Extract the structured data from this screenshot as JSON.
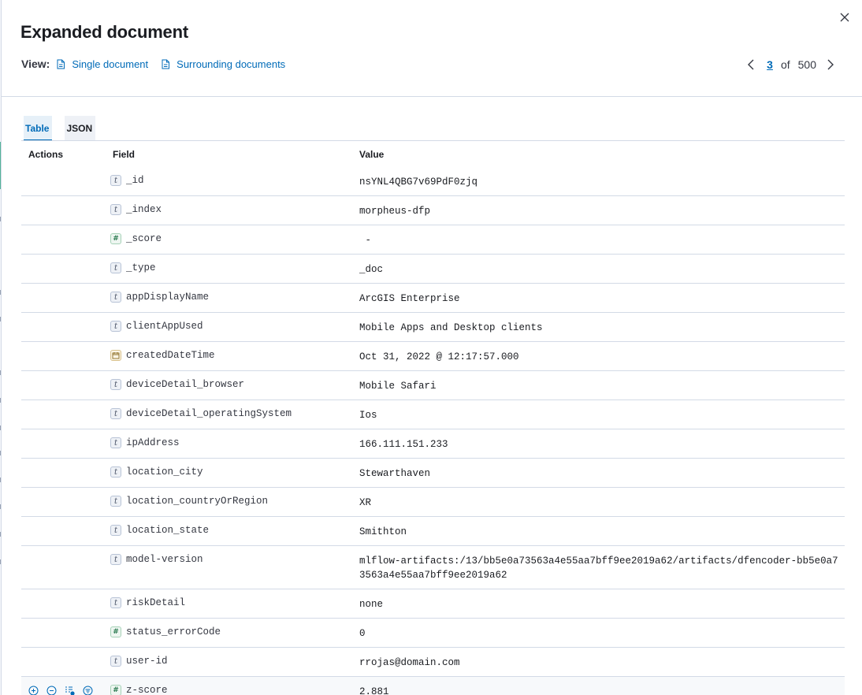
{
  "flyout": {
    "title": "Expanded document",
    "view_label": "View:",
    "view_links": [
      "Single document",
      "Surrounding documents"
    ]
  },
  "pager": {
    "current": "3",
    "of": "of",
    "total": "500"
  },
  "tabs": [
    {
      "label": "Table",
      "active": true
    },
    {
      "label": "JSON",
      "active": false
    }
  ],
  "table": {
    "headers": {
      "actions": "Actions",
      "field": "Field",
      "value": "Value"
    },
    "rows": [
      {
        "type": "t",
        "field": "_id",
        "value": "nsYNL4QBG7v69PdF0zjq"
      },
      {
        "type": "t",
        "field": "_index",
        "value": "morpheus-dfp"
      },
      {
        "type": "num",
        "field": "_score",
        "value": " -"
      },
      {
        "type": "t",
        "field": "_type",
        "value": "_doc"
      },
      {
        "type": "t",
        "field": "appDisplayName",
        "value": "ArcGIS Enterprise"
      },
      {
        "type": "t",
        "field": "clientAppUsed",
        "value": "Mobile Apps and Desktop clients"
      },
      {
        "type": "date",
        "field": "createdDateTime",
        "value": "Oct 31, 2022 @ 12:17:57.000"
      },
      {
        "type": "t",
        "field": "deviceDetail_browser",
        "value": "Mobile Safari"
      },
      {
        "type": "t",
        "field": "deviceDetail_operatingSystem",
        "value": "Ios"
      },
      {
        "type": "t",
        "field": "ipAddress",
        "value": "166.111.151.233"
      },
      {
        "type": "t",
        "field": "location_city",
        "value": "Stewarthaven"
      },
      {
        "type": "t",
        "field": "location_countryOrRegion",
        "value": "XR"
      },
      {
        "type": "t",
        "field": "location_state",
        "value": "Smithton"
      },
      {
        "type": "t",
        "field": "model-version",
        "value": "mlflow-artifacts:/13/bb5e0a73563a4e55aa7bff9ee2019a62/artifacts/dfencoder-bb5e0a73563a4e55aa7bff9ee2019a62"
      },
      {
        "type": "t",
        "field": "riskDetail",
        "value": "none"
      },
      {
        "type": "num",
        "field": "status_errorCode",
        "value": "0"
      },
      {
        "type": "t",
        "field": "user-id",
        "value": "rrojas@domain.com"
      },
      {
        "type": "num",
        "field": "z-score",
        "value": "2.881",
        "hover": true
      }
    ]
  },
  "colors": {
    "link": "#006bb8",
    "border": "#d3dae6",
    "text": "#1a1c21",
    "accent_green": "#54b399"
  },
  "icons": {
    "close": "close-icon",
    "doc": "document-icon",
    "prev": "chevron-left-icon",
    "next": "chevron-right-icon",
    "filter_in": "magnify-plus-icon",
    "filter_out": "magnify-minus-icon",
    "toggle_column": "list-add-icon",
    "filter_exists": "filter-icon"
  }
}
